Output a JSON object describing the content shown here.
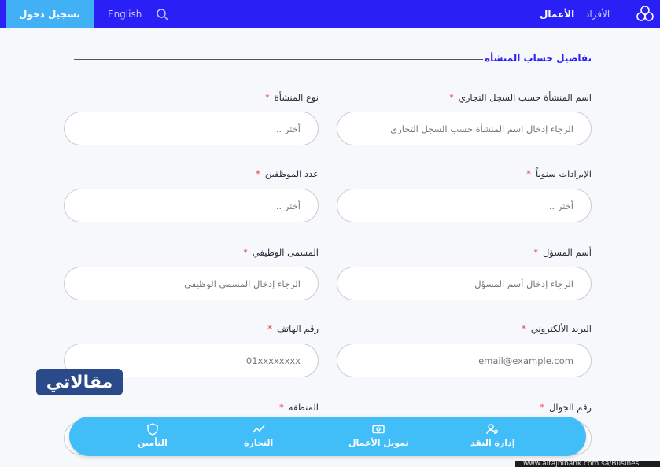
{
  "header": {
    "login_label": "تسجيل دخول",
    "lang_label": "English",
    "nav_business": "الأعمال",
    "nav_individuals": "الأفراد"
  },
  "section": {
    "title": "تفاصيل حساب المنشأة"
  },
  "fields": {
    "company_name": {
      "label": "اسم المنشأة حسب السجل التجاري",
      "placeholder": "الرجاء إدخال  اسم المنشأة حسب السجل التجاري"
    },
    "company_type": {
      "label": "نوع المنشأة",
      "placeholder": "أختر .."
    },
    "revenue": {
      "label": "الإيرادات سنوياً",
      "placeholder": "أختر .."
    },
    "employees": {
      "label": "عدد الموظفين",
      "placeholder": "أختر .."
    },
    "officer_name": {
      "label": "أسم المسؤل",
      "placeholder": "الرجاء إدخال  أسم المسؤل"
    },
    "job_title": {
      "label": "المسمى الوظيفي",
      "placeholder": "الرجاء إدخال  المسمى الوظيفي"
    },
    "email": {
      "label": "البريد الألكتروني",
      "placeholder": "email@example.com"
    },
    "phone": {
      "label": "رقم الهاتف",
      "placeholder": "01xxxxxxxx"
    },
    "mobile": {
      "label": "رقم الجوال"
    },
    "region": {
      "label": "المنطقة"
    },
    "required_mark": "*"
  },
  "watermark": {
    "text": "مقالاتي"
  },
  "bottom_nav": {
    "cash": "إدارة النقد",
    "financing": "تمويل الأعمال",
    "trade": "التجارة",
    "insurance": "التأمين"
  },
  "url_strip": "www.alrajhibank.com.sa/Busines",
  "colors": {
    "primary": "#2a1ff5",
    "accent": "#41b0f5",
    "required": "#e8343a"
  }
}
